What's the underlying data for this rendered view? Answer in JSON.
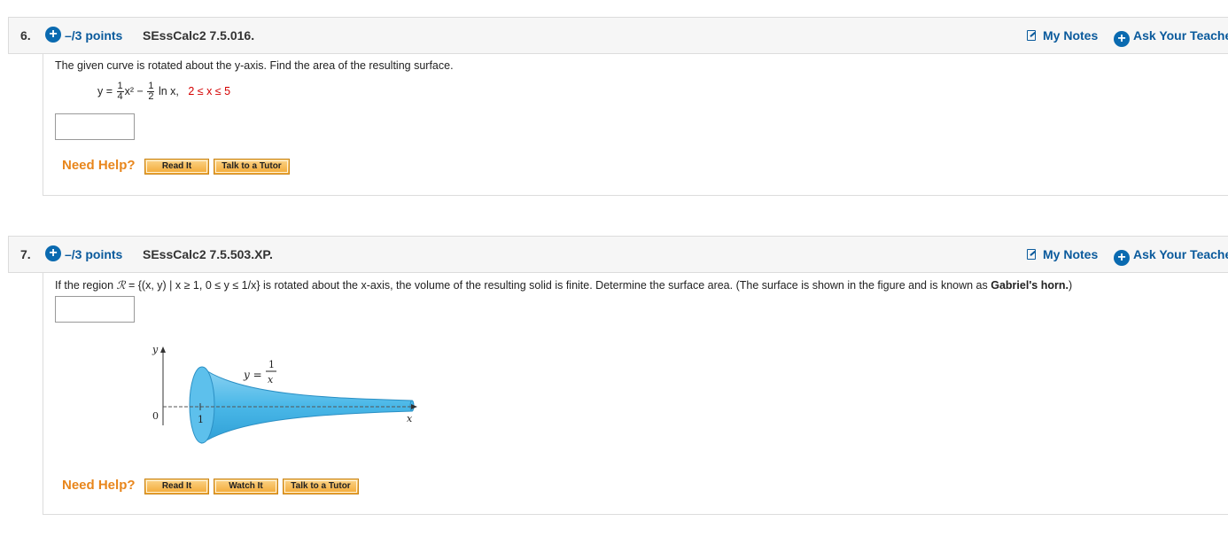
{
  "q6": {
    "number": "6.",
    "points": "–/3 points",
    "id": "SEssCalc2 7.5.016.",
    "my_notes": "My Notes",
    "ask_teacher": "Ask Your Teache",
    "text": "The given curve is rotated about the y-axis. Find the area of the resulting surface.",
    "eq_y": "y =",
    "frac1_num": "1",
    "frac1_den": "4",
    "x2": "x²",
    "minus": "−",
    "frac2_num": "1",
    "frac2_den": "2",
    "lnx": "ln x,",
    "range": "2 ≤ x ≤ 5",
    "answer": "",
    "need_help": "Need Help?",
    "read_it": "Read It",
    "talk_tutor": "Talk to a Tutor"
  },
  "q7": {
    "number": "7.",
    "points": "–/3 points",
    "id": "SEssCalc2 7.5.503.XP.",
    "my_notes": "My Notes",
    "ask_teacher": "Ask Your Teache",
    "text_a": "If the region",
    "text_b": "= {(x, y) | x ≥ 1, 0 ≤ y ≤ 1/x}  is rotated about the x-axis, the volume of the resulting solid is finite. Determine the surface area. (The surface is shown in the figure and is known as",
    "text_bold": "Gabriel's horn.",
    "text_end": ")",
    "answer": "",
    "figure": {
      "y_axis": "y",
      "x_axis": "x",
      "origin": "0",
      "tick": "1",
      "curve_lhs": "y =",
      "curve_num": "1",
      "curve_den": "x"
    },
    "need_help": "Need Help?",
    "read_it": "Read It",
    "watch_it": "Watch It",
    "talk_tutor": "Talk to a Tutor"
  },
  "colors": {
    "accent": "#0a5a9c",
    "help": "#e8861c",
    "horn": "#4ab8e8",
    "range": "#d40000"
  }
}
